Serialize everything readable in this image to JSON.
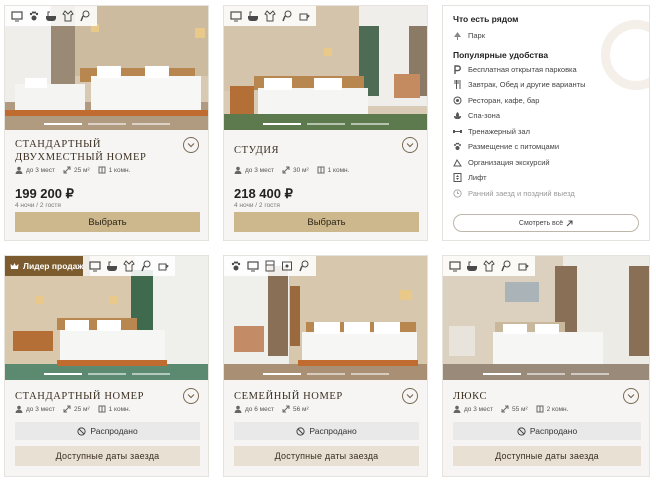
{
  "colors": {
    "accent": "#cdb88e",
    "accent_dark": "#7c5c2f",
    "sold": "#e9e9e9",
    "dates": "#e8e0d2"
  },
  "rooms": [
    {
      "name": "Стандартный двухместный номер",
      "icons": [
        "tv-icon",
        "pet-icon",
        "bath-icon",
        "bathrobe-icon",
        "hairdryer-icon"
      ],
      "guests": "до 3 мест",
      "area": "25 м²",
      "rooms": "1 комн.",
      "price": "199 200 ₽",
      "nights": "4 ночи / 2 гостя",
      "action": "Выбрать"
    },
    {
      "name": "Студия",
      "icons": [
        "tv-icon",
        "bath-icon",
        "bathrobe-icon",
        "hairdryer-icon",
        "kettle-icon"
      ],
      "guests": "до 3 мест",
      "area": "30 м²",
      "rooms": "1 комн.",
      "price": "218 400 ₽",
      "nights": "4 ночи / 2 гостя",
      "action": "Выбрать"
    },
    {
      "name": "Стандартный номер",
      "badge": "Лидер продаж",
      "icons": [
        "tv-icon",
        "bath-icon",
        "bathrobe-icon",
        "hairdryer-icon",
        "kettle-icon"
      ],
      "guests": "до 3 мест",
      "area": "25 м²",
      "rooms": "1 комн.",
      "sold": "Распродано",
      "dates": "Доступные даты заезда"
    },
    {
      "name": "Семейный номер",
      "icons": [
        "pet-icon",
        "tv-icon",
        "minibar-icon",
        "safe-icon",
        "hairdryer-icon"
      ],
      "guests": "до 6 мест",
      "area": "56 м²",
      "rooms": "",
      "sold": "Распродано",
      "dates": "Доступные даты заезда"
    },
    {
      "name": "Люкс",
      "icons": [
        "tv-icon",
        "bath-icon",
        "bathrobe-icon",
        "hairdryer-icon",
        "kettle-icon"
      ],
      "guests": "до 3 мест",
      "area": "55 м²",
      "rooms": "2 комн.",
      "sold": "Распродано",
      "dates": "Доступные даты заезда"
    }
  ],
  "sidebar": {
    "nearby_title": "Что есть рядом",
    "nearby": [
      {
        "icon": "park-icon",
        "label": "Парк"
      }
    ],
    "amenities_title": "Популярные удобства",
    "amenities": [
      {
        "icon": "parking-icon",
        "label": "Бесплатная открытая парковка"
      },
      {
        "icon": "fork-icon",
        "label": "Завтрак, Обед и другие варианты"
      },
      {
        "icon": "restaurant-icon",
        "label": "Ресторан, кафе, бар"
      },
      {
        "icon": "spa-icon",
        "label": "Спа-зона"
      },
      {
        "icon": "gym-icon",
        "label": "Тренажерный зал"
      },
      {
        "icon": "pet-icon",
        "label": "Размещение с питомцами"
      },
      {
        "icon": "tour-icon",
        "label": "Организация экскурсий"
      },
      {
        "icon": "elevator-icon",
        "label": "Лифт"
      },
      {
        "icon": "clock-icon",
        "label": "Ранний заезд и поздний выезд"
      }
    ],
    "see_all": "Смотреть всё"
  }
}
